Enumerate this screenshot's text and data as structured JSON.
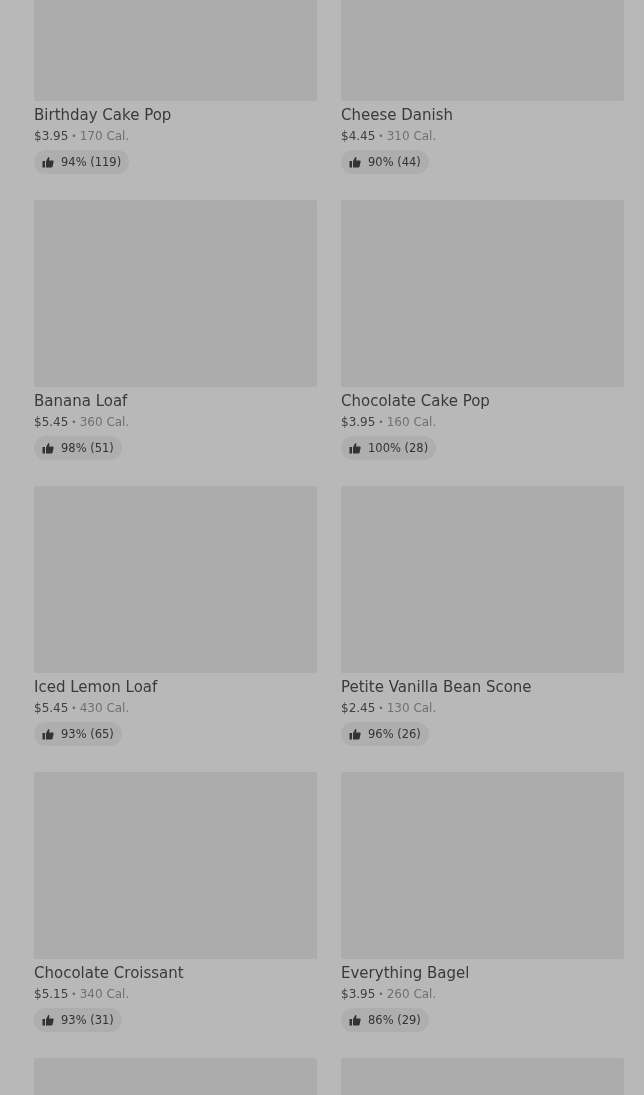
{
  "products": [
    {
      "kind": "product",
      "name": "Birthday Cake Pop",
      "price": "$3.95",
      "separator": "•",
      "calories": "170 Cal.",
      "rating": "94% (119)"
    },
    {
      "kind": "product",
      "name": "Cheese Danish",
      "price": "$4.45",
      "separator": "•",
      "calories": "310 Cal.",
      "rating": "90% (44)"
    },
    {
      "kind": "product",
      "name": "Banana Loaf",
      "price": "$5.45",
      "separator": "•",
      "calories": "360 Cal.",
      "rating": "98% (51)"
    },
    {
      "kind": "product",
      "name": "Chocolate Cake Pop",
      "price": "$3.95",
      "separator": "•",
      "calories": "160 Cal.",
      "rating": "100% (28)"
    },
    {
      "kind": "product",
      "name": "Iced Lemon Loaf",
      "price": "$5.45",
      "separator": "•",
      "calories": "430 Cal.",
      "rating": "93% (65)"
    },
    {
      "kind": "product",
      "name": "Petite Vanilla Bean Scone",
      "price": "$2.45",
      "separator": "•",
      "calories": "130 Cal.",
      "rating": "96% (26)"
    },
    {
      "kind": "product",
      "name": "Chocolate Croissant",
      "price": "$5.15",
      "separator": "•",
      "calories": "340 Cal.",
      "rating": "93% (31)"
    },
    {
      "kind": "product",
      "name": "Everything Bagel",
      "price": "$3.95",
      "separator": "•",
      "calories": "260 Cal.",
      "rating": "86% (29)"
    },
    {
      "kind": "image-only"
    },
    {
      "kind": "image-only"
    }
  ]
}
